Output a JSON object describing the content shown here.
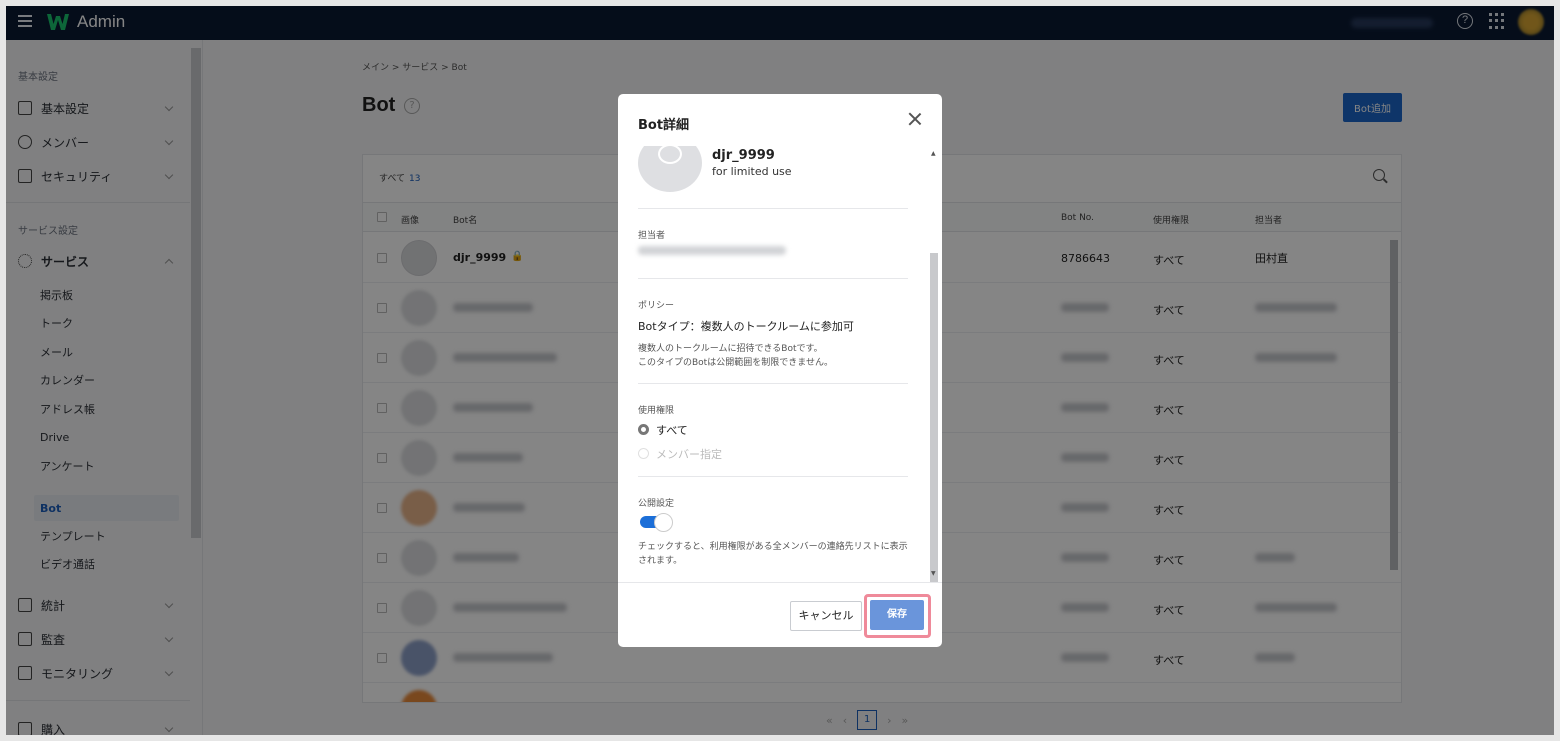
{
  "app": {
    "title": "Admin"
  },
  "sidebar": {
    "section_basic": "基本設定",
    "basic_items": [
      {
        "label": "基本設定",
        "icon": "building-icon"
      },
      {
        "label": "メンバー",
        "icon": "people-icon"
      },
      {
        "label": "セキュリティ",
        "icon": "lock-icon"
      }
    ],
    "section_service": "サービス設定",
    "service_label": "サービス",
    "service_items": [
      "掲示板",
      "トーク",
      "メール",
      "カレンダー",
      "アドレス帳",
      "Drive",
      "アンケート",
      "Bot",
      "テンプレート",
      "ビデオ通話"
    ],
    "active_item": "Bot",
    "other_items": [
      {
        "label": "統計",
        "icon": "chart-icon"
      },
      {
        "label": "監査",
        "icon": "audit-icon"
      },
      {
        "label": "モニタリング",
        "icon": "monitor-icon"
      },
      {
        "label": "購入",
        "icon": "card-icon"
      }
    ]
  },
  "main": {
    "breadcrumb": "メイン > サービス > Bot",
    "title": "Bot",
    "add_button": "Bot追加",
    "filter_label": "すべて",
    "filter_count": "13",
    "columns": {
      "image": "画像",
      "name": "Bot名",
      "number": "Bot No.",
      "permission": "使用権限",
      "owner": "担当者"
    },
    "first_row": {
      "name": "djr_9999",
      "number": "8786643",
      "permission": "すべて",
      "owner": "田村直"
    },
    "rows_permission": "すべて",
    "pager": {
      "first": "«",
      "prev": "‹",
      "current": "1",
      "next": "›",
      "last": "»"
    }
  },
  "modal": {
    "title": "Bot詳細",
    "bot_name": "djr_9999",
    "bot_desc": "for limited use",
    "owner_label": "担当者",
    "policy_label": "ポリシー",
    "policy_main": "Botタイプ：複数人のトークルームに参加可",
    "policy_sub_1": "複数人のトークルームに招待できるBotです。",
    "policy_sub_2": "このタイプのBotは公開範囲を制限できません。",
    "perm_label": "使用権限",
    "perm_opt_all": "すべて",
    "perm_opt_member": "メンバー指定",
    "public_label": "公開設定",
    "public_on": true,
    "public_help": "チェックすると、利用権限がある全メンバーの連絡先リストに表示されます。",
    "cancel": "キャンセル",
    "save": "保存"
  }
}
